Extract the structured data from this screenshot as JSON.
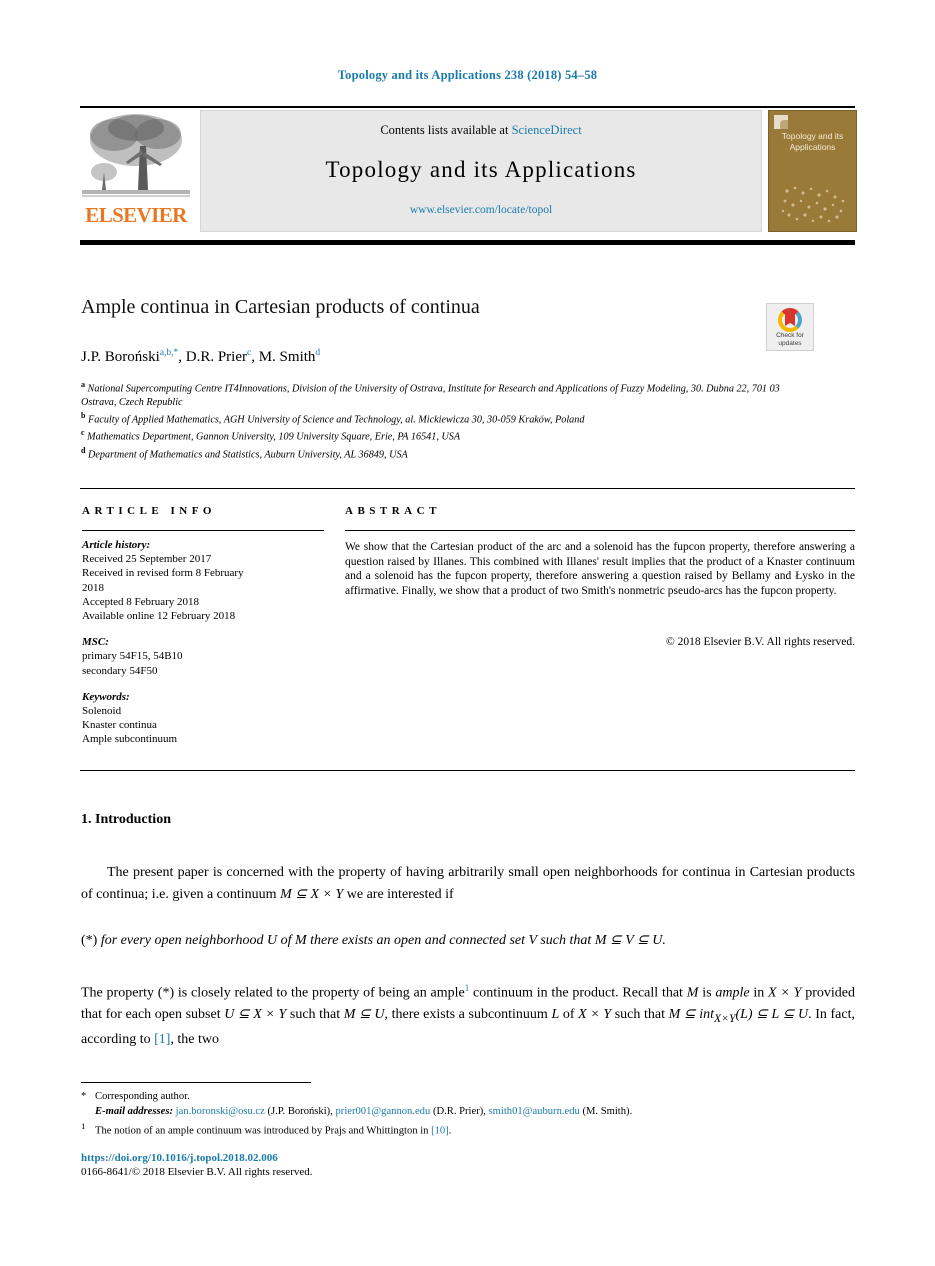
{
  "running_head": "Topology and its Applications 238 (2018) 54–58",
  "masthead": {
    "publisher_name": "ELSEVIER",
    "contents_prefix": "Contents lists available at ",
    "contents_link": "ScienceDirect",
    "journal_name": "Topology and its Applications",
    "journal_url": "www.elsevier.com/locate/topol",
    "cover_title": "Topology and its Applications"
  },
  "article": {
    "title": "Ample continua in Cartesian products of continua",
    "crossmark_label_line1": "Check for",
    "crossmark_label_line2": "updates",
    "authors": [
      {
        "name": "J.P. Boroński",
        "marks": "a,b,*"
      },
      {
        "name": "D.R. Prier",
        "marks": "c"
      },
      {
        "name": "M. Smith",
        "marks": "d"
      }
    ],
    "affiliations": [
      {
        "mark": "a",
        "text": "National Supercomputing Centre IT4Innovations, Division of the University of Ostrava, Institute for Research and Applications of Fuzzy Modeling, 30. Dubna 22, 701 03 Ostrava, Czech Republic"
      },
      {
        "mark": "b",
        "text": "Faculty of Applied Mathematics, AGH University of Science and Technology, al. Mickiewicza 30, 30-059 Kraków, Poland"
      },
      {
        "mark": "c",
        "text": "Mathematics Department, Gannon University, 109 University Square, Erie, PA 16541, USA"
      },
      {
        "mark": "d",
        "text": "Department of Mathematics and Statistics, Auburn University, AL 36849, USA"
      }
    ]
  },
  "info": {
    "heading": "ARTICLE INFO",
    "history_label": "Article history:",
    "history_lines": [
      "Received 25 September 2017",
      "Received in revised form 8 February",
      "2018",
      "Accepted 8 February 2018",
      "Available online 12 February 2018"
    ],
    "msc_label": "MSC:",
    "msc_lines": [
      "primary 54F15, 54B10",
      "secondary 54F50"
    ],
    "keywords_label": "Keywords:",
    "keywords": [
      "Solenoid",
      "Knaster continua",
      "Ample subcontinuum"
    ]
  },
  "abstract": {
    "heading": "ABSTRACT",
    "text": "We show that the Cartesian product of the arc and a solenoid has the fupcon property, therefore answering a question raised by Illanes. This combined with Illanes' result implies that the product of a Knaster continuum and a solenoid has the fupcon property, therefore answering a question raised by Bellamy and Łysko in the affirmative. Finally, we show that a product of two Smith's nonmetric pseudo-arcs has the fupcon property.",
    "copyright": "© 2018 Elsevier B.V. All rights reserved."
  },
  "body": {
    "section_heading": "1. Introduction",
    "paragraph1_before": "The present paper is concerned with the property of having arbitrarily small open neighborhoods for continua in Cartesian products of continua; i.e. given a continuum ",
    "paragraph1_math": "M ⊆ X × Y",
    "paragraph1_after": " we are interested if",
    "starred_label": "(*)",
    "starred_text_a": "for every open neighborhood ",
    "starred_U": "U",
    "starred_text_b": " of ",
    "starred_M": "M",
    "starred_text_c": " there exists an open and connected set ",
    "starred_V": "V",
    "starred_text_d": " such that ",
    "starred_incl": "M ⊆ V ⊆ U",
    "starred_end": ".",
    "paragraph2_p1": "The property (*) is closely related to the property of being an ample",
    "paragraph2_fn": "1",
    "paragraph2_p2": " continuum in the product. Recall that ",
    "paragraph2_m1": "M",
    "paragraph2_p3": " is ",
    "paragraph2_ample": "ample",
    "paragraph2_p4": " in ",
    "paragraph2_m2": "X × Y",
    "paragraph2_p5": " provided that for each open subset ",
    "paragraph2_m3": "U ⊆ X × Y",
    "paragraph2_p6": " such that ",
    "paragraph2_m4": "M ⊆ U",
    "paragraph2_p7": ", there exists a subcontinuum ",
    "paragraph2_m5": "L",
    "paragraph2_p8": " of ",
    "paragraph2_m6": "X × Y",
    "paragraph2_p9": " such that ",
    "paragraph2_m7": "M ⊆ int",
    "paragraph2_m7sub": "X×Y",
    "paragraph2_m7b": "(L) ⊆ L ⊆ U",
    "paragraph2_p10": ". In fact, according to ",
    "paragraph2_ref": "[1]",
    "paragraph2_p11": ", the two"
  },
  "footnotes": {
    "corresponding_mark": "*",
    "corresponding_text": "Corresponding author.",
    "email_label": "E-mail addresses:",
    "emails": [
      {
        "address": "jan.boronski@osu.cz",
        "owner": "(J.P. Boroński)"
      },
      {
        "address": "prier001@gannon.edu",
        "owner": "(D.R. Prier)"
      },
      {
        "address": "smith01@auburn.edu",
        "owner": "(M. Smith)"
      }
    ],
    "fn1_mark": "1",
    "fn1_before": "The notion of an ample continuum was introduced by Prajs and Whittington in ",
    "fn1_ref": "[10]",
    "fn1_after": "."
  },
  "footer": {
    "doi": "https://doi.org/10.1016/j.topol.2018.02.006",
    "issn": "0166-8641/© 2018 Elsevier B.V. All rights reserved."
  },
  "colors": {
    "link": "#1a7bab",
    "elsevier_orange": "#E87722",
    "cover_gold": "#9a7a38"
  }
}
